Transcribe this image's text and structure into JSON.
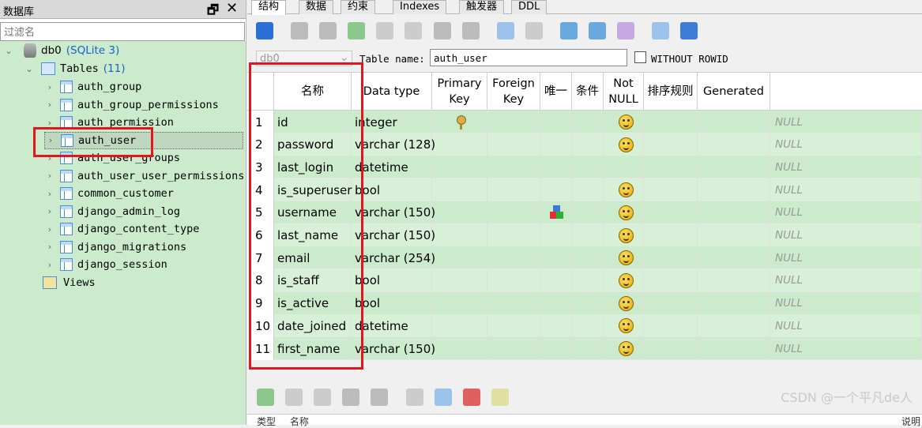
{
  "left_panel": {
    "title": "数据库",
    "filter_placeholder": "过滤名",
    "db_name": "db0",
    "db_type": "(SQLite 3)",
    "tables_label": "Tables",
    "tables_count": "(11)",
    "views_label": "Views",
    "tables": [
      "auth_group",
      "auth_group_permissions",
      "auth_permission",
      "auth_user",
      "auth_user_groups",
      "auth_user_user_permissions",
      "common_customer",
      "django_admin_log",
      "django_content_type",
      "django_migrations",
      "django_session"
    ],
    "selected_table": "auth_user"
  },
  "tabs": [
    "结构",
    "数据",
    "约束",
    "Indexes",
    "触发器",
    "DDL"
  ],
  "active_tab": "结构",
  "schema_select": "db0",
  "table_name_label": "Table name:",
  "table_name_value": "auth_user",
  "without_rowid_label": "WITHOUT ROWID",
  "columns": [
    "名称",
    "Data type",
    "Primary Key",
    "Foreign Key",
    "唯一",
    "条件",
    "Not NULL",
    "排序规则",
    "Generated"
  ],
  "rows": [
    {
      "n": "1",
      "name": "id",
      "type": "integer",
      "pk": true,
      "unique": false,
      "notnull": true,
      "default": "NULL"
    },
    {
      "n": "2",
      "name": "password",
      "type": "varchar (128)",
      "pk": false,
      "unique": false,
      "notnull": true,
      "default": "NULL"
    },
    {
      "n": "3",
      "name": "last_login",
      "type": "datetime",
      "pk": false,
      "unique": false,
      "notnull": false,
      "default": "NULL"
    },
    {
      "n": "4",
      "name": "is_superuser",
      "type": "bool",
      "pk": false,
      "unique": false,
      "notnull": true,
      "default": "NULL"
    },
    {
      "n": "5",
      "name": "username",
      "type": "varchar (150)",
      "pk": false,
      "unique": true,
      "notnull": true,
      "default": "NULL"
    },
    {
      "n": "6",
      "name": "last_name",
      "type": "varchar (150)",
      "pk": false,
      "unique": false,
      "notnull": true,
      "default": "NULL"
    },
    {
      "n": "7",
      "name": "email",
      "type": "varchar (254)",
      "pk": false,
      "unique": false,
      "notnull": true,
      "default": "NULL"
    },
    {
      "n": "8",
      "name": "is_staff",
      "type": "bool",
      "pk": false,
      "unique": false,
      "notnull": true,
      "default": "NULL"
    },
    {
      "n": "9",
      "name": "is_active",
      "type": "bool",
      "pk": false,
      "unique": false,
      "notnull": true,
      "default": "NULL"
    },
    {
      "n": "10",
      "name": "date_joined",
      "type": "datetime",
      "pk": false,
      "unique": false,
      "notnull": true,
      "default": "NULL"
    },
    {
      "n": "11",
      "name": "first_name",
      "type": "varchar (150)",
      "pk": false,
      "unique": false,
      "notnull": true,
      "default": "NULL"
    }
  ],
  "bottom_labels": [
    "类型",
    "名称",
    "说明"
  ],
  "watermark": "CSDN @一个平凡de人"
}
